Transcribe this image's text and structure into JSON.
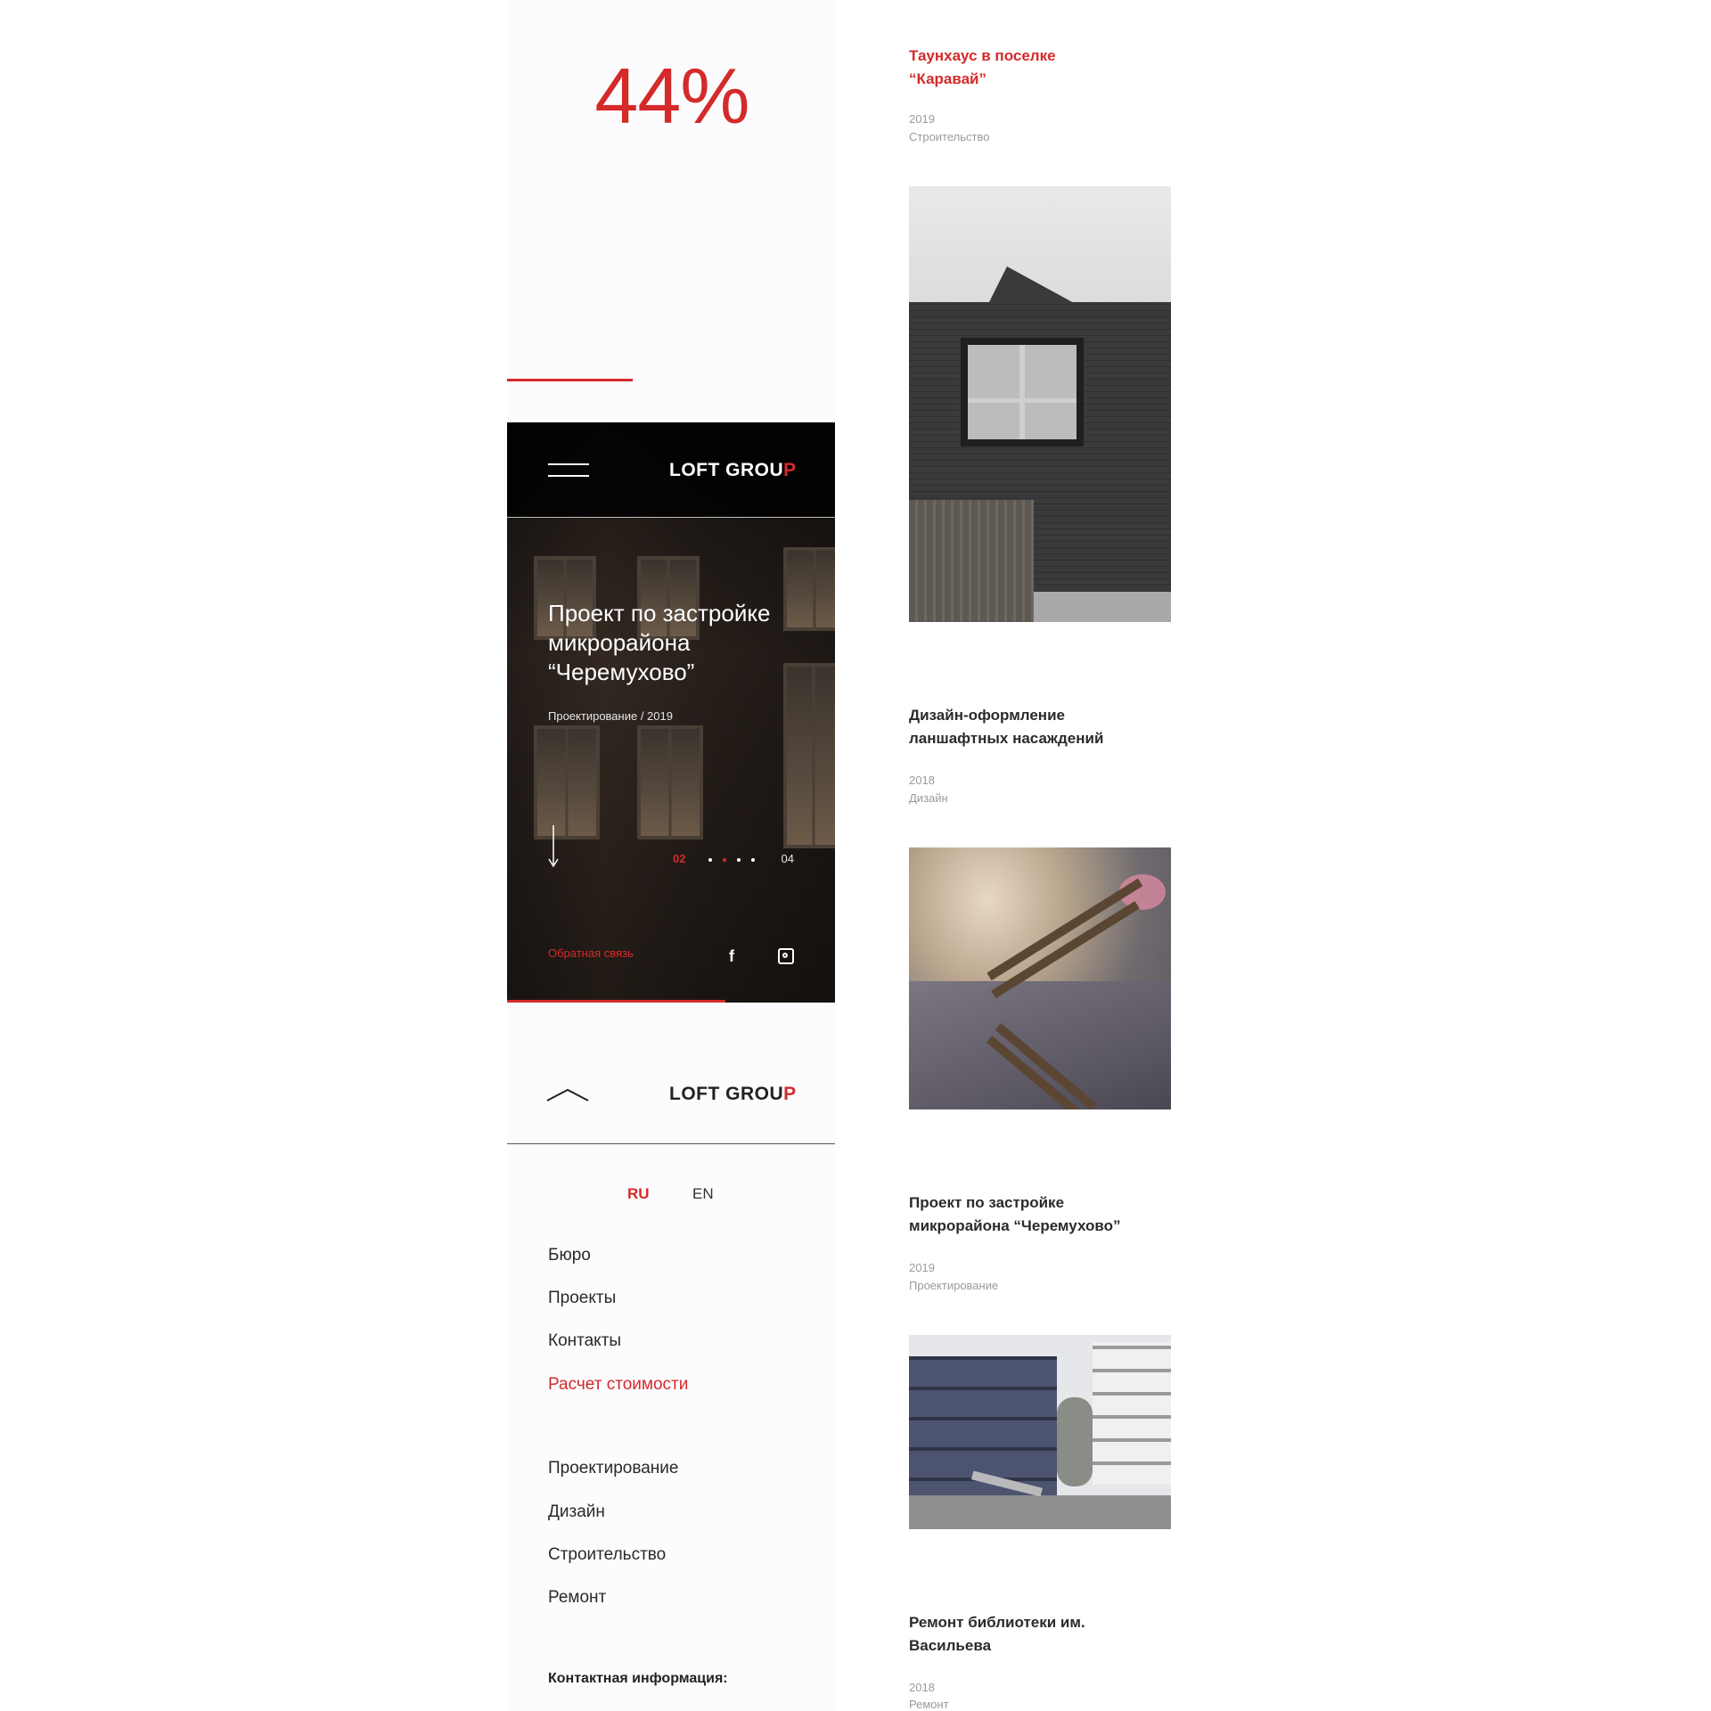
{
  "loader": {
    "percent_text": "44%",
    "progress": 0.44
  },
  "hero": {
    "logo_text": "LOFT GROU",
    "logo_accent": "P",
    "title": "Проект по застройке микрорайона “Черемухово”",
    "meta": "Проектирование / 2019",
    "pager_current": "02",
    "pager_total": "04",
    "feedback_label": "Обратная связь",
    "social": [
      "facebook-icon",
      "instagram-icon"
    ]
  },
  "menu": {
    "logo_text": "LOFT GROU",
    "logo_accent": "P",
    "languages": {
      "ru": "RU",
      "en": "EN",
      "active": "RU"
    },
    "nav": [
      "Бюро",
      "Проекты",
      "Контакты",
      "Расчет стоимости"
    ],
    "services": [
      "Проектирование",
      "Дизайн",
      "Строительство",
      "Ремонт"
    ],
    "contact_title": "Контактная информация:"
  },
  "projects": [
    {
      "title": "Таунхаус в поселке “Каравай”",
      "year": "2019",
      "category": "Строительство",
      "highlighted": true
    },
    {
      "title": "Дизайн-оформление ланшафтных насаждений",
      "year": "2018",
      "category": "Дизайн",
      "highlighted": false
    },
    {
      "title": "Проект по застройке микрорайона “Черемухово”",
      "year": "2019",
      "category": "Проектирование",
      "highlighted": false
    },
    {
      "title": "Ремонт библиотеки им. Васильева",
      "year": "2018",
      "category": "Ремонт",
      "highlighted": false
    }
  ],
  "colors": {
    "accent": "#d42a2a",
    "dark": "#222222",
    "muted": "#9a9a9a"
  }
}
